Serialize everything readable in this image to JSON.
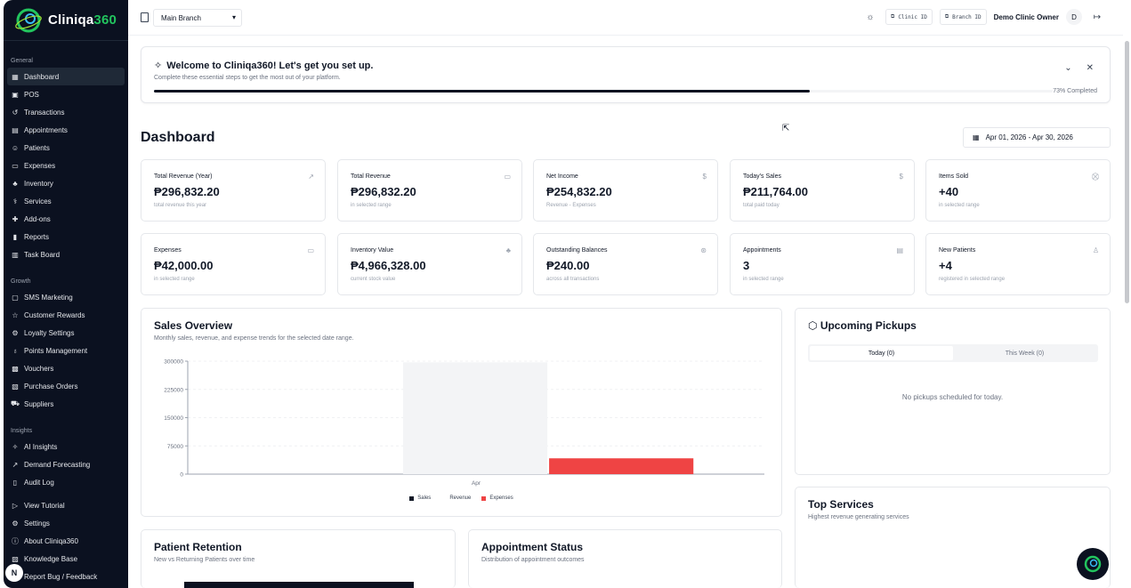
{
  "sidebar": {
    "logo": {
      "prefix": "Cliniqa",
      "suffix": "360"
    },
    "sections": {
      "general": "General",
      "growth": "Growth",
      "insights": "Insights"
    },
    "general_items": [
      {
        "label": "Dashboard",
        "icon": "grid-icon"
      },
      {
        "label": "POS",
        "icon": "register-icon"
      },
      {
        "label": "Transactions",
        "icon": "history-icon"
      },
      {
        "label": "Appointments",
        "icon": "calendar-icon"
      },
      {
        "label": "Patients",
        "icon": "users-icon"
      },
      {
        "label": "Expenses",
        "icon": "wallet-icon"
      },
      {
        "label": "Inventory",
        "icon": "boxes-icon"
      },
      {
        "label": "Services",
        "icon": "service-icon"
      },
      {
        "label": "Add-ons",
        "icon": "puzzle-icon"
      },
      {
        "label": "Reports",
        "icon": "bar-chart-icon"
      },
      {
        "label": "Task Board",
        "icon": "kanban-icon"
      }
    ],
    "growth_items": [
      {
        "label": "SMS Marketing",
        "icon": "message-icon"
      },
      {
        "label": "Customer Rewards",
        "icon": "star-icon"
      },
      {
        "label": "Loyalty Settings",
        "icon": "gear-icon"
      },
      {
        "label": "Points Management",
        "icon": "award-icon"
      },
      {
        "label": "Vouchers",
        "icon": "ticket-icon"
      },
      {
        "label": "Purchase Orders",
        "icon": "clipboard-icon"
      },
      {
        "label": "Suppliers",
        "icon": "truck-icon"
      }
    ],
    "insights_items": [
      {
        "label": "AI Insights",
        "icon": "sparkle-icon"
      },
      {
        "label": "Demand Forecasting",
        "icon": "trend-icon"
      },
      {
        "label": "Audit Log",
        "icon": "file-icon"
      }
    ],
    "footer_items": [
      {
        "label": "View Tutorial",
        "icon": "play-icon"
      },
      {
        "label": "Settings",
        "icon": "gear-icon"
      },
      {
        "label": "About Cliniqa360",
        "icon": "info-icon"
      },
      {
        "label": "Knowledge Base",
        "icon": "book-icon"
      },
      {
        "label": "Report Bug / Feedback",
        "icon": "bug-icon"
      }
    ]
  },
  "topbar": {
    "branch": "Main Branch",
    "clinic_id": "Clinic ID",
    "branch_id": "Branch ID",
    "owner": "Demo Clinic Owner",
    "avatar": "D"
  },
  "welcome": {
    "title": "Welcome to Cliniqa360! Let's get you set up.",
    "subtitle": "Complete these essential steps to get the most out of your platform.",
    "progress": 73,
    "progress_label": "73% Completed"
  },
  "page": {
    "title": "Dashboard",
    "date_range": "Apr 01, 2026 - Apr 30, 2026"
  },
  "stats": [
    {
      "label": "Total Revenue (Year)",
      "value": "₱296,832.20",
      "sub": "total revenue this year",
      "icon": "trend-up-icon"
    },
    {
      "label": "Total Revenue",
      "value": "₱296,832.20",
      "sub": "in selected range",
      "icon": "card-icon"
    },
    {
      "label": "Net Income",
      "value": "₱254,832.20",
      "sub": "Revenue - Expenses",
      "icon": "dollar-icon"
    },
    {
      "label": "Today's Sales",
      "value": "₱211,764.00",
      "sub": "total paid today",
      "icon": "dollar-icon"
    },
    {
      "label": "Items Sold",
      "value": "+40",
      "sub": "in selected range",
      "icon": "cart-icon"
    },
    {
      "label": "Expenses",
      "value": "₱42,000.00",
      "sub": "in selected range",
      "icon": "wallet-icon"
    },
    {
      "label": "Inventory Value",
      "value": "₱4,966,328.00",
      "sub": "current stock value",
      "icon": "boxes-icon"
    },
    {
      "label": "Outstanding Balances",
      "value": "₱240.00",
      "sub": "across all transactions",
      "icon": "alert-icon"
    },
    {
      "label": "Appointments",
      "value": "3",
      "sub": "in selected range",
      "icon": "calendar-icon"
    },
    {
      "label": "New Patients",
      "value": "+4",
      "sub": "registered in selected range",
      "icon": "user-plus-icon"
    }
  ],
  "sales_overview": {
    "title": "Sales Overview",
    "subtitle": "Monthly sales, revenue, and expense trends for the selected date range."
  },
  "upcoming_pickups": {
    "title": "Upcoming Pickups",
    "tabs": [
      "Today (0)",
      "This Week (0)"
    ],
    "empty": "No pickups scheduled for today."
  },
  "top_services": {
    "title": "Top Services",
    "subtitle": "Highest revenue generating services"
  },
  "patient_retention": {
    "title": "Patient Retention",
    "subtitle": "New vs Returning Patients over time"
  },
  "appointment_status": {
    "title": "Appointment Status",
    "subtitle": "Distribution of appointment outcomes"
  },
  "chart_data": {
    "type": "bar",
    "categories": [
      "Apr"
    ],
    "series": [
      {
        "name": "Sales",
        "values": [
          0
        ],
        "color": "#111827"
      },
      {
        "name": "Revenue",
        "values": [
          296832.2
        ],
        "color": "#f3f4f6"
      },
      {
        "name": "Expenses",
        "values": [
          42000
        ],
        "color": "#ef4444"
      }
    ],
    "ylim": [
      0,
      300000
    ],
    "yticks": [
      "0",
      "75000",
      "150000",
      "225000",
      "300000"
    ],
    "grid": true,
    "legend": "bottom"
  },
  "help_fab": "N"
}
